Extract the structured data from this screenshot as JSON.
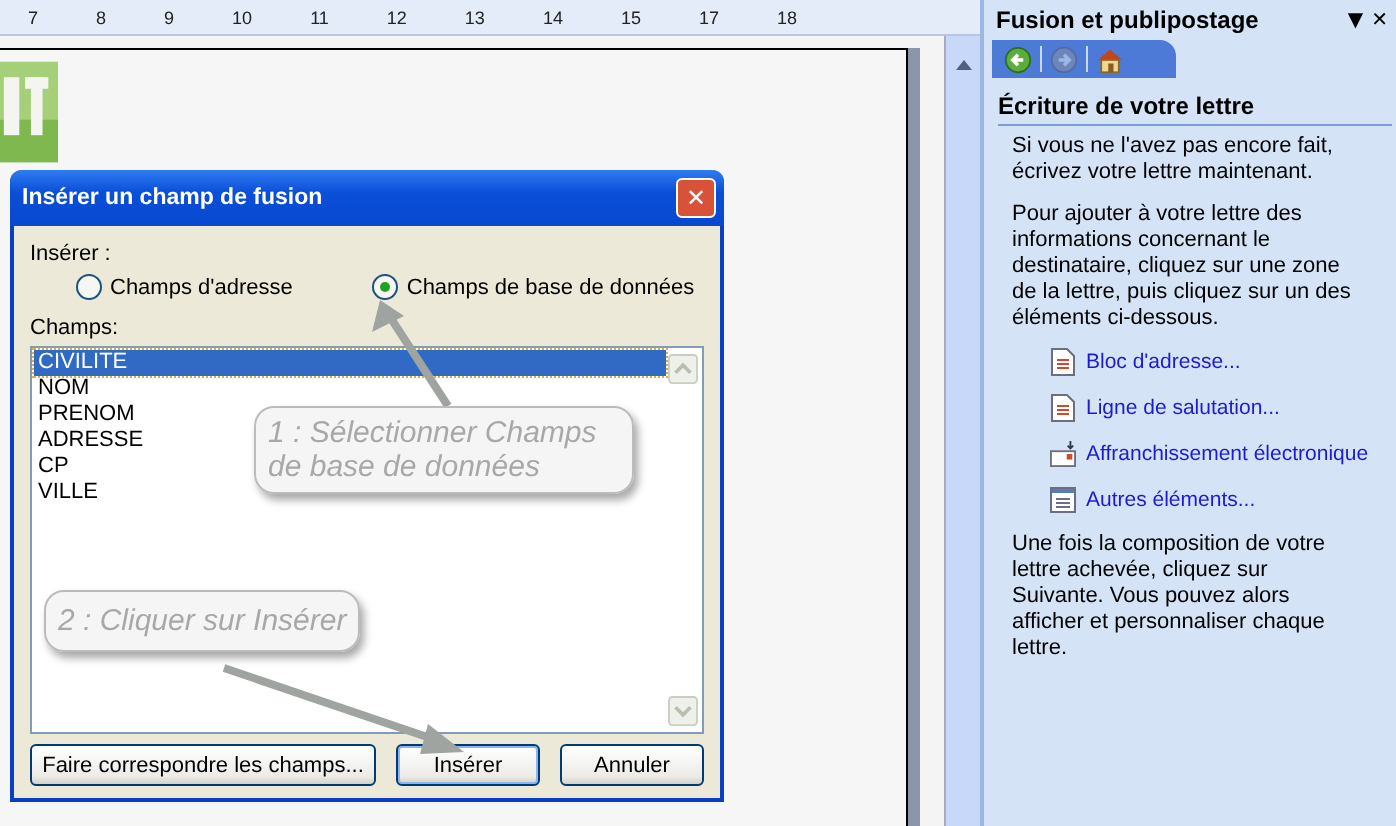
{
  "ruler": {
    "labels": [
      "7",
      "8",
      "9",
      "10",
      "11",
      "12",
      "13",
      "14",
      "15",
      "17",
      "18"
    ]
  },
  "dialog": {
    "title": "Insérer un champ de fusion",
    "close": "✕",
    "insert_label": "Insérer :",
    "radios": [
      {
        "label": "Champs d'adresse",
        "selected": false
      },
      {
        "label": "Champs de base de données",
        "selected": true
      }
    ],
    "fields_label": "Champs:",
    "fields": [
      {
        "label": "CIVILITE",
        "selected": true
      },
      {
        "label": "NOM",
        "selected": false
      },
      {
        "label": "PRENOM",
        "selected": false
      },
      {
        "label": "ADRESSE",
        "selected": false
      },
      {
        "label": "CP",
        "selected": false
      },
      {
        "label": "VILLE",
        "selected": false
      }
    ],
    "buttons": [
      {
        "label": "Faire correspondre les champs...",
        "default": false
      },
      {
        "label": "Insérer",
        "default": true
      },
      {
        "label": "Annuler",
        "default": false
      }
    ]
  },
  "callouts": [
    {
      "text": "1 : Sélectionner Champs de base de données"
    },
    {
      "text": "2 : Cliquer sur Insérer"
    }
  ],
  "task_pane": {
    "title": "Fusion et publipostage",
    "menu": "▼",
    "close": "✕",
    "nav": [
      {
        "kind": "back",
        "disabled": false
      },
      {
        "kind": "forward",
        "disabled": true
      },
      {
        "kind": "home",
        "disabled": false
      }
    ],
    "heading": "Écriture de votre lettre",
    "paragraphs": [
      "Si vous ne l'avez pas encore fait, écrivez votre lettre maintenant.",
      "Pour ajouter à votre lettre des informations concernant le destinataire, cliquez sur une zone de la lettre, puis cliquez sur un des éléments ci-dessous."
    ],
    "links": [
      {
        "label": "Bloc d'adresse...",
        "kind": "doc"
      },
      {
        "label": "Ligne de salutation...",
        "kind": "doc"
      },
      {
        "label": "Affranchissement électronique",
        "kind": "postage"
      },
      {
        "label": "Autres éléments...",
        "kind": "list"
      }
    ],
    "closing": "Une fois la composition de votre lettre achevée, cliquez sur Suivante. Vous pouvez alors afficher et personnaliser chaque lettre."
  }
}
